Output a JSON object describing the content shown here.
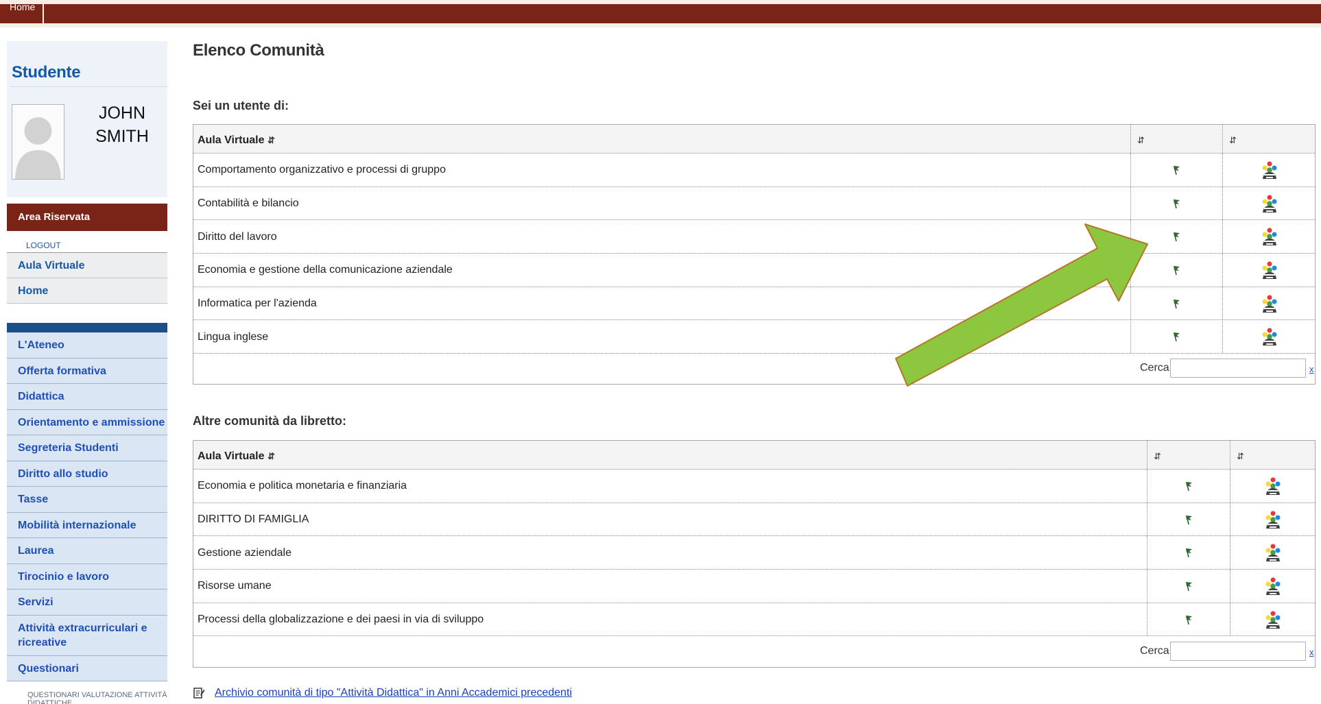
{
  "topbar": {
    "home_label": "Home"
  },
  "sidebar": {
    "student_title": "Studente",
    "student_name_line1": "JOHN",
    "student_name_line2": "SMITH",
    "area_header": "Area Riservata",
    "logout": "LOGOUT",
    "reserved_items": [
      "Aula Virtuale",
      "Home"
    ],
    "nav_items": [
      "L'Ateneo",
      "Offerta formativa",
      "Didattica",
      "Orientamento e ammissione",
      "Segreteria Studenti",
      "Diritto allo studio",
      "Tasse",
      "Mobilità internazionale",
      "Laurea",
      "Tirocinio e lavoro",
      "Servizi",
      "Attività extracurriculari e ricreative",
      "Questionari"
    ],
    "nav_sub": "QUESTIONARI VALUTAZIONE ATTIVITÀ DIDATTICHE"
  },
  "main": {
    "page_title": "Elenco Comunità",
    "section1_title": "Sei un utente di:",
    "section2_title": "Altre comunità da libretto:",
    "column_header": "Aula Virtuale",
    "sort_icon": "sort-arrows-icon",
    "cerca_label": "Cerca:",
    "cerca_clear": "x",
    "table1_rows": [
      "Comportamento organizzativo e processi di gruppo",
      "Contabilità e bilancio",
      "Diritto del lavoro",
      "Economia e gestione della comunicazione aziendale",
      "Informatica per l'azienda",
      "Lingua inglese"
    ],
    "table2_rows": [
      "Economia e politica monetaria e finanziaria",
      "DIRITTO DI FAMIGLIA",
      "Gestione aziendale",
      "Risorse umane",
      "Processi della globalizzazione e dei paesi in via di sviluppo"
    ],
    "archive_link": "Archivio comunità di tipo \"Attività Didattica\" in Anni Accademici precedenti"
  },
  "colors": {
    "brand_red": "#7a2418",
    "link_blue": "#1559a6",
    "nav_bg": "#dbe6f4",
    "annotation_arrow": "#8dc63f"
  }
}
